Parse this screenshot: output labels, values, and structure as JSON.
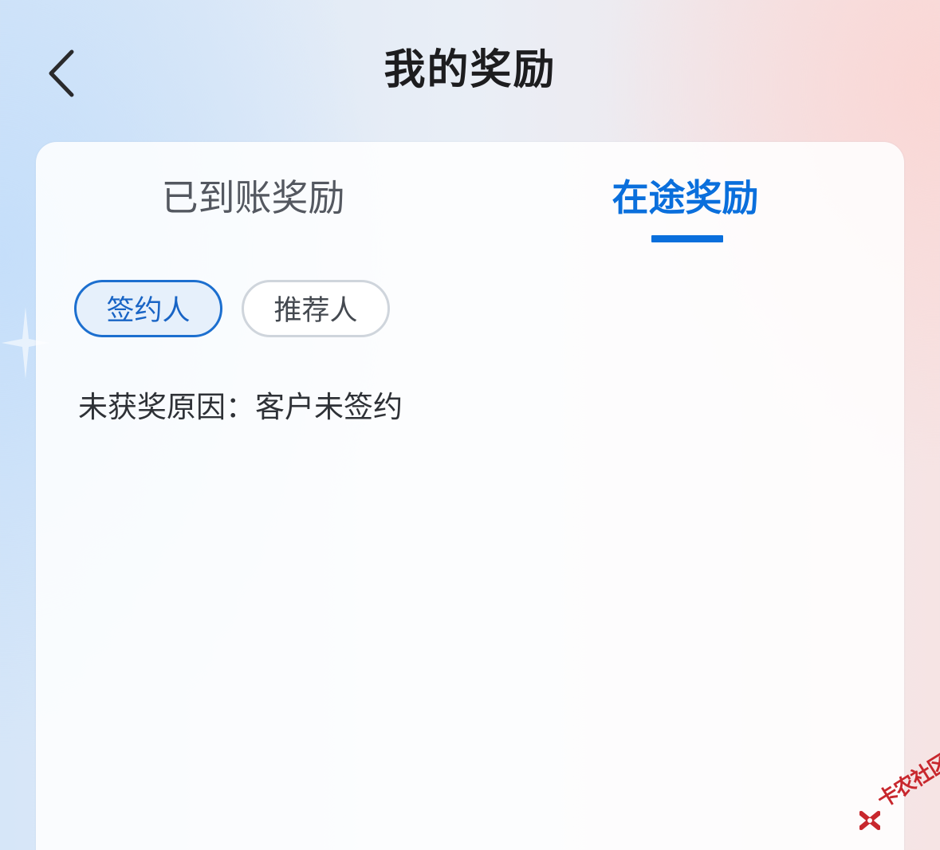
{
  "header": {
    "title": "我的奖励",
    "back_icon": "chevron-left-icon"
  },
  "tabs": [
    {
      "label": "已到账奖励",
      "active": false
    },
    {
      "label": "在途奖励",
      "active": true
    }
  ],
  "filters": [
    {
      "label": "签约人",
      "selected": true
    },
    {
      "label": "推荐人",
      "selected": false
    }
  ],
  "reason": {
    "text": "未获奖原因：客户未签约"
  },
  "watermark": {
    "text": "卡农社区"
  },
  "colors": {
    "accent": "#0a6fdc",
    "chip_selected_bg": "#e6f0fb",
    "chip_border_inactive": "#cfd5dc",
    "watermark": "#c8272d"
  }
}
